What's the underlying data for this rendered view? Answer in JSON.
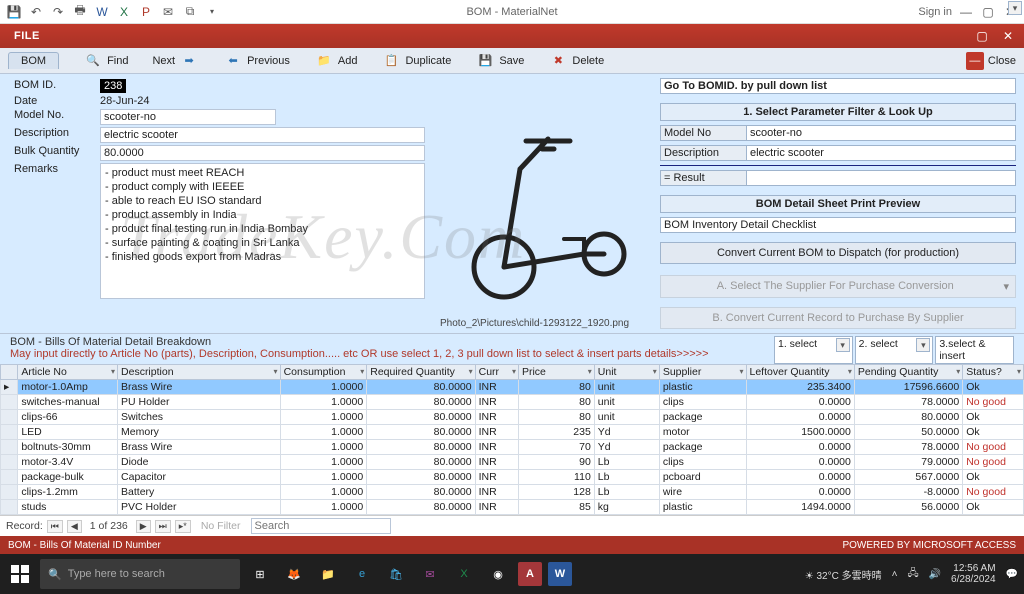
{
  "window": {
    "title": "BOM - MaterialNet",
    "signin": "Sign in",
    "file_tab": "FILE"
  },
  "cmdbar": {
    "bom_tab": "BOM",
    "find": "Find",
    "next": "Next",
    "previous": "Previous",
    "add": "Add",
    "duplicate": "Duplicate",
    "save": "Save",
    "delete": "Delete",
    "close": "Close"
  },
  "form": {
    "bomid_label": "BOM ID.",
    "bomid_value": "238",
    "date_label": "Date",
    "date_value": "28-Jun-24",
    "model_label": "Model No.",
    "model_value": "scooter-no",
    "desc_label": "Description",
    "desc_value": "electric scooter",
    "bulk_label": "Bulk Quantity",
    "bulk_value": "80.0000",
    "remarks_label": "Remarks",
    "remarks_value": "- product must meet REACH\n- product comply with IEEEE\n- able to reach EU ISO standard\n- product assembly in India\n- product final testing run in India Bombay\n- surface painting & coating in Sri Lanka\n- finished goods export from Madras",
    "photo_path": "Photo_2\\Pictures\\child-1293122_1920.png"
  },
  "rpane": {
    "goto_label": "Go To BOMID. by pull down list",
    "sec1_title": "1. Select Parameter Filter & Look Up",
    "model_k": "Model No",
    "model_v": "scooter-no",
    "desc_k": "Description",
    "desc_v": "electric scooter",
    "result_k": "= Result",
    "sec2_title": "BOM Detail Sheet Print Preview",
    "sec2_value": "BOM Inventory Detail Checklist",
    "convert_btn": "Convert Current BOM to Dispatch (for production)",
    "supA": "A. Select The Supplier For Purchase Conversion",
    "supB": "B. Convert Current Record to Purchase By Supplier"
  },
  "breakdown": {
    "title": "BOM - Bills Of Material Detail Breakdown",
    "hint": "May input directly to Article No (parts), Description, Consumption..... etc  OR use select 1, 2, 3 pull down list to select & insert parts details>>>>>",
    "sel1": "1. select",
    "sel2": "2. select",
    "sel3": "3.select & insert"
  },
  "grid": {
    "cols": [
      "Article No",
      "Description",
      "Consumption",
      "Required Quantity",
      "Curr",
      "Price",
      "Unit",
      "Supplier",
      "Leftover Quantity",
      "Pending Quantity",
      "Status?"
    ],
    "rows": [
      {
        "a": "motor-1.0Amp",
        "d": "Brass Wire",
        "c": "1.0000",
        "rq": "80.0000",
        "cu": "INR",
        "p": "80",
        "u": "unit",
        "s": "plastic",
        "lo": "235.3400",
        "pq": "17596.6600",
        "st": "Ok",
        "sel": true
      },
      {
        "a": "switches-manual",
        "d": "PU Holder",
        "c": "1.0000",
        "rq": "80.0000",
        "cu": "INR",
        "p": "80",
        "u": "unit",
        "s": "clips",
        "lo": "0.0000",
        "pq": "78.0000",
        "st": "No good"
      },
      {
        "a": "clips-66",
        "d": "Switches",
        "c": "1.0000",
        "rq": "80.0000",
        "cu": "INR",
        "p": "80",
        "u": "unit",
        "s": "package",
        "lo": "0.0000",
        "pq": "80.0000",
        "st": "Ok"
      },
      {
        "a": "LED",
        "d": "Memory",
        "c": "1.0000",
        "rq": "80.0000",
        "cu": "INR",
        "p": "235",
        "u": "Yd",
        "s": "motor",
        "lo": "1500.0000",
        "pq": "50.0000",
        "st": "Ok"
      },
      {
        "a": "boltnuts-30mm",
        "d": "Brass Wire",
        "c": "1.0000",
        "rq": "80.0000",
        "cu": "INR",
        "p": "70",
        "u": "Yd",
        "s": "package",
        "lo": "0.0000",
        "pq": "78.0000",
        "st": "No good"
      },
      {
        "a": "motor-3.4V",
        "d": "Diode",
        "c": "1.0000",
        "rq": "80.0000",
        "cu": "INR",
        "p": "90",
        "u": "Lb",
        "s": "clips",
        "lo": "0.0000",
        "pq": "79.0000",
        "st": "No good"
      },
      {
        "a": "package-bulk",
        "d": "Capacitor",
        "c": "1.0000",
        "rq": "80.0000",
        "cu": "INR",
        "p": "110",
        "u": "Lb",
        "s": "pcboard",
        "lo": "0.0000",
        "pq": "567.0000",
        "st": "Ok"
      },
      {
        "a": "clips-1.2mm",
        "d": "Battery",
        "c": "1.0000",
        "rq": "80.0000",
        "cu": "INR",
        "p": "128",
        "u": "Lb",
        "s": "wire",
        "lo": "0.0000",
        "pq": "-8.0000",
        "st": "No good"
      },
      {
        "a": "studs",
        "d": "PVC Holder",
        "c": "1.0000",
        "rq": "80.0000",
        "cu": "INR",
        "p": "85",
        "u": "kg",
        "s": "plastic",
        "lo": "1494.0000",
        "pq": "56.0000",
        "st": "Ok"
      }
    ]
  },
  "recnav": {
    "label": "Record:",
    "pos": "1 of 236",
    "nofilter": "No Filter",
    "search_ph": "Search"
  },
  "access_status": {
    "left": "BOM - Bills Of Material ID Number",
    "right": "POWERED BY MICROSOFT ACCESS"
  },
  "taskbar": {
    "search_ph": "Type here to search",
    "weather": "32°C  多雲時晴",
    "time": "12:56 AM",
    "date": "6/28/2024"
  },
  "watermark": "TradeKey.Com"
}
